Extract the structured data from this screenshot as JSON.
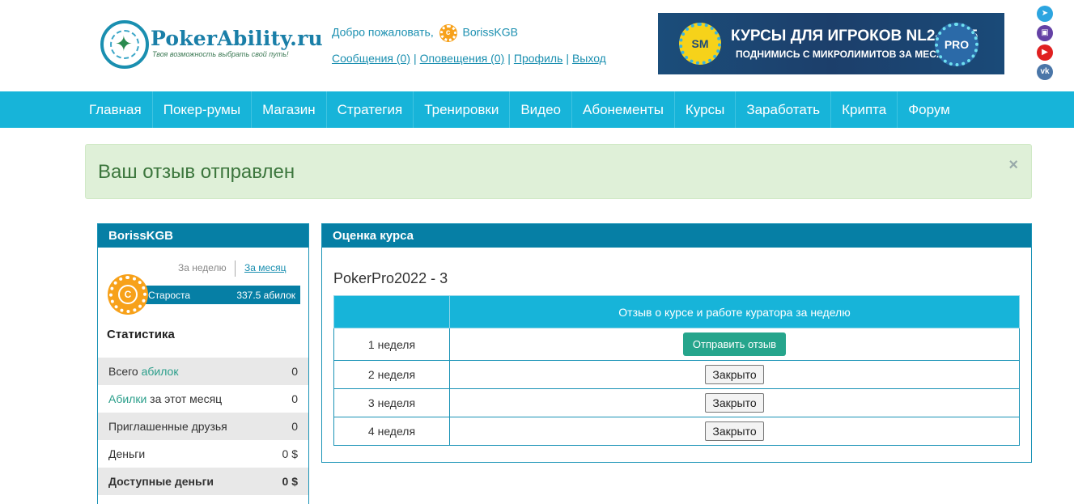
{
  "brand": {
    "name": "PokerAbility.ru",
    "tagline": "Твоя возможность выбрать свой путь!"
  },
  "header": {
    "welcome_text": "Добро пожаловать,",
    "username": "BorissKGB",
    "links": [
      "Сообщения (0)",
      "Оповещения (0)",
      "Профиль",
      "Выход"
    ],
    "banner": {
      "sm_badge": "SM",
      "line1": "КУРСЫ ДЛЯ ИГРОКОВ NL2-NL25",
      "line2": "ПОДНИМИСЬ С МИКРОЛИМИТОВ ЗА МЕСЯЦ",
      "pro_badge": "PRO"
    },
    "social": [
      "telegram-icon",
      "twitch-icon",
      "youtube-icon",
      "vk-icon"
    ]
  },
  "nav": {
    "items": [
      "Главная",
      "Покер-румы",
      "Магазин",
      "Стратегия",
      "Тренировки",
      "Видео",
      "Абонементы",
      "Курсы",
      "Заработать",
      "Крипта",
      "Форум"
    ]
  },
  "alert": {
    "message": "Ваш отзыв отправлен",
    "close": "×"
  },
  "sidebar": {
    "title": "BorissKGB",
    "period_week": "За неделю",
    "period_month": "За месяц",
    "chip_letter": "C",
    "rank_name": "Староста",
    "rank_value": "337.5 абилок",
    "stats_title": "Статистика",
    "stats": [
      {
        "prefix": "Всего ",
        "link": "абилок",
        "suffix": "",
        "value": "0"
      },
      {
        "prefix": "",
        "link": "Абилки",
        "suffix": " за этот месяц",
        "value": "0"
      },
      {
        "prefix": "Приглашенные друзья",
        "link": "",
        "suffix": "",
        "value": "0"
      },
      {
        "prefix": "Деньги",
        "link": "",
        "suffix": "",
        "value": "0 $"
      },
      {
        "prefix": "Доступные деньги",
        "link": "",
        "suffix": "",
        "value": "0 $"
      }
    ]
  },
  "course_panel": {
    "title": "Оценка курса",
    "course_name": "PokerPro2022 - 3",
    "table_header_left": "",
    "table_header_right": "Отзыв о курсе и работе куратора за неделю",
    "rows": [
      {
        "week": "1 неделя",
        "action": "Отправить отзыв",
        "type": "send"
      },
      {
        "week": "2 неделя",
        "action": "Закрыто",
        "type": "closed"
      },
      {
        "week": "3 неделя",
        "action": "Закрыто",
        "type": "closed"
      },
      {
        "week": "4 неделя",
        "action": "Закрыто",
        "type": "closed"
      }
    ]
  },
  "colors": {
    "nav_bg": "#17b4d9",
    "panel_head": "#067fa5",
    "alert_bg": "#dff0d8",
    "alert_text": "#3c763d",
    "send_button": "#26a58c",
    "chip": "#f7a11a"
  }
}
